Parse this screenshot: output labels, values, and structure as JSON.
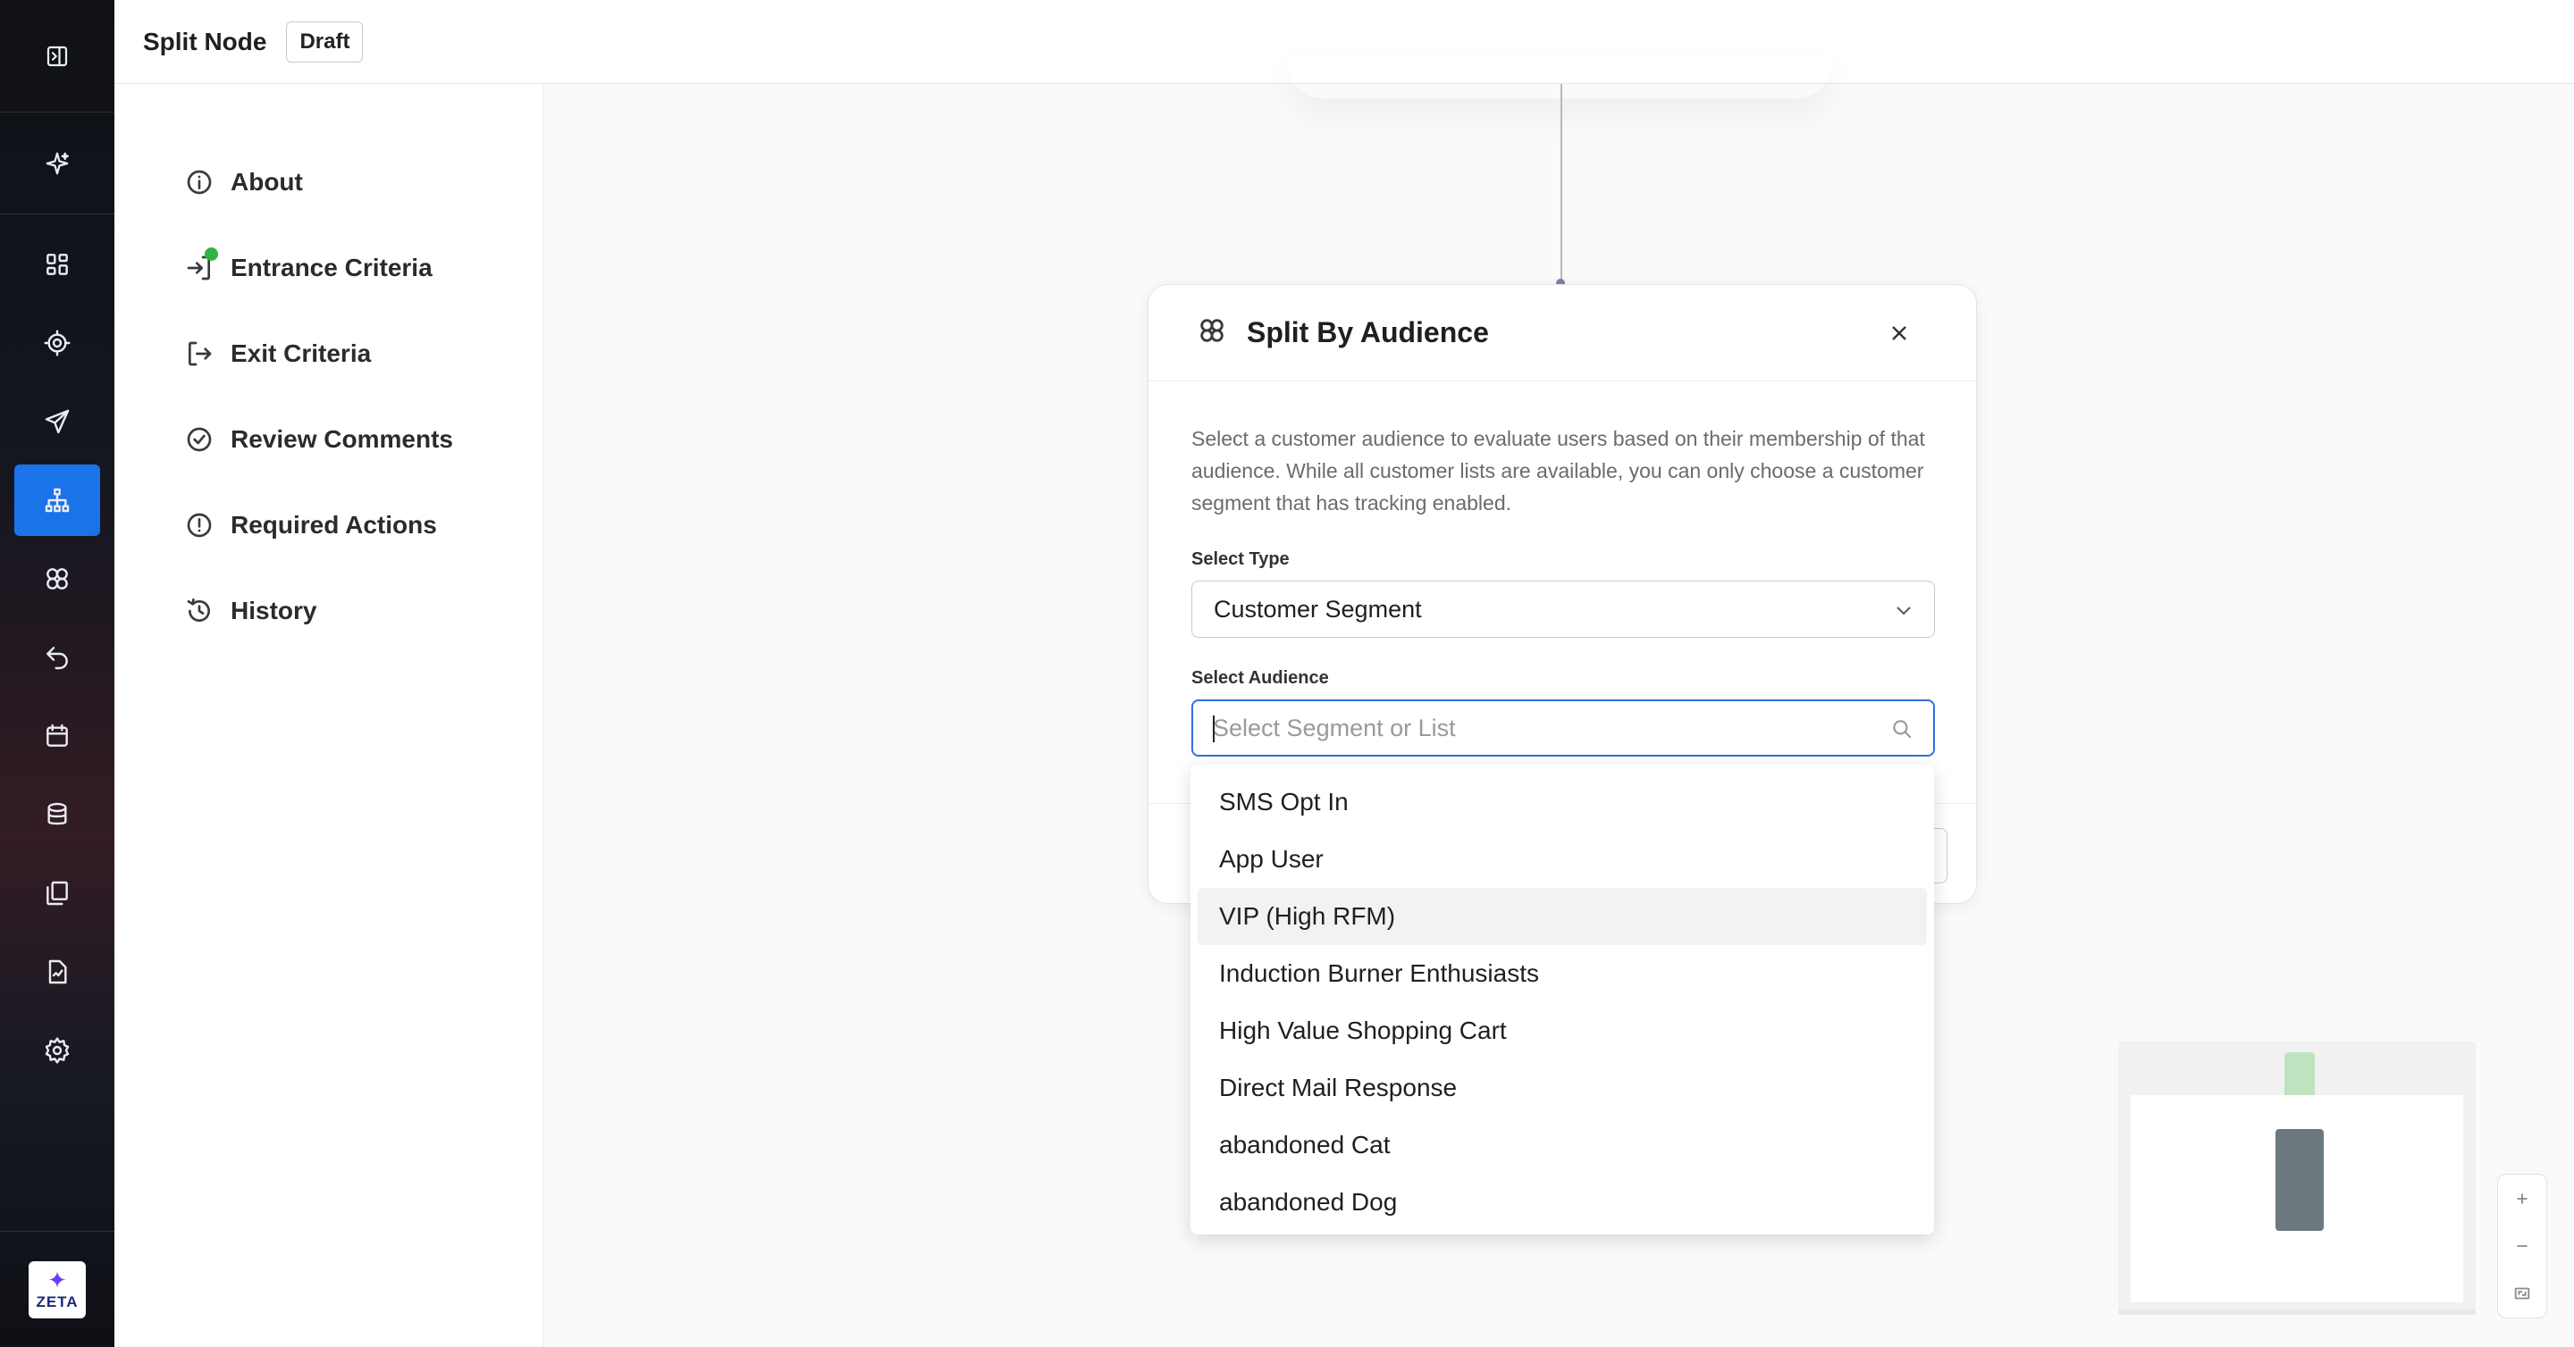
{
  "header": {
    "title": "Split Node",
    "status_badge": "Draft"
  },
  "rail": {
    "items": [
      {
        "icon": "grid-dashboard-icon"
      },
      {
        "icon": "target-icon"
      },
      {
        "icon": "send-icon"
      },
      {
        "icon": "journey-tree-icon",
        "active": true
      },
      {
        "icon": "audience-icon"
      },
      {
        "icon": "undo-flow-icon"
      },
      {
        "icon": "calendar-icon"
      },
      {
        "icon": "database-icon"
      },
      {
        "icon": "library-icon"
      },
      {
        "icon": "report-icon"
      },
      {
        "icon": "settings-icon"
      }
    ],
    "logo_text": "ZETA",
    "accent": "#1a73e8"
  },
  "side_menu": {
    "items": [
      {
        "label": "About",
        "icon": "info-icon"
      },
      {
        "label": "Entrance Criteria",
        "icon": "enter-icon",
        "status_dot": "#2fb344"
      },
      {
        "label": "Exit Criteria",
        "icon": "exit-icon"
      },
      {
        "label": "Review Comments",
        "icon": "check-circle-icon"
      },
      {
        "label": "Required Actions",
        "icon": "alert-circle-icon"
      },
      {
        "label": "History",
        "icon": "history-icon"
      }
    ]
  },
  "modal": {
    "title": "Split By Audience",
    "description": "Select a customer audience to evaluate users based on their membership of that audience. While all customer lists are available, you can only choose a customer segment that has tracking enabled.",
    "select_type_label": "Select Type",
    "select_type_value": "Customer Segment",
    "select_audience_label": "Select Audience",
    "audience_placeholder": "Select Segment or List"
  },
  "dropdown": {
    "options": [
      "SMS Opt In",
      "App User",
      "VIP (High RFM)",
      "Induction Burner Enthusiasts",
      "High Value Shopping Cart",
      "Direct Mail Response",
      "abandoned Cat",
      "abandoned Dog"
    ],
    "hovered": "VIP (High RFM)"
  }
}
